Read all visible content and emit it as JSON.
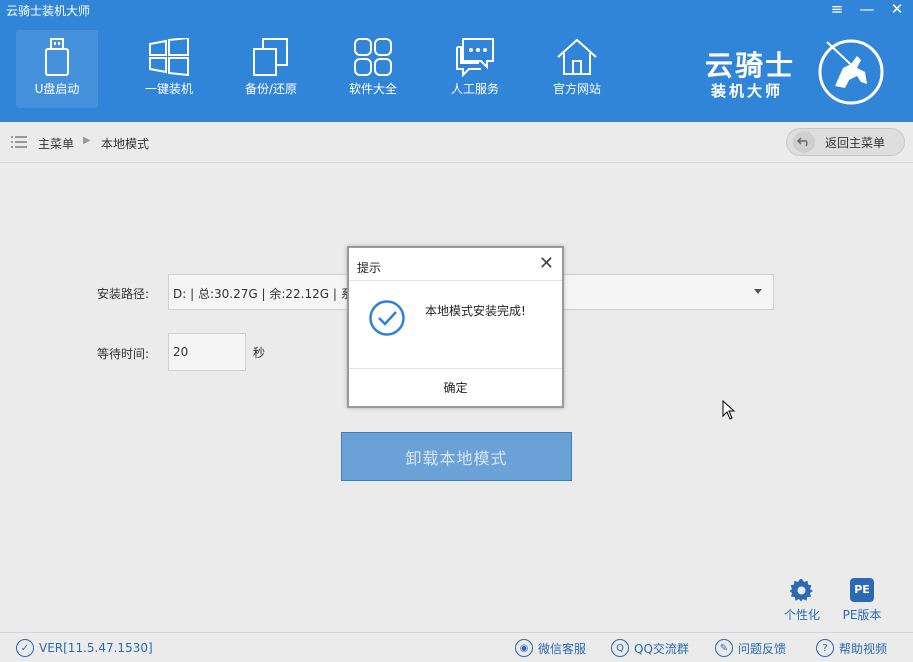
{
  "app": {
    "title": "云骑士装机大师"
  },
  "window_controls": {
    "menu": "≡",
    "minimize": "—",
    "close": "✕"
  },
  "nav": [
    {
      "label": "U盘启动",
      "icon": "usb-drive-icon"
    },
    {
      "label": "一键装机",
      "icon": "windows-icon"
    },
    {
      "label": "备份/还原",
      "icon": "backup-icon"
    },
    {
      "label": "软件大全",
      "icon": "apps-grid-icon"
    },
    {
      "label": "人工服务",
      "icon": "chat-icon"
    },
    {
      "label": "官方网站",
      "icon": "home-icon"
    }
  ],
  "brand": {
    "name": "云骑士",
    "sub": "装机大师"
  },
  "breadcrumb": {
    "main": "主菜单",
    "separator": "▶",
    "current": "本地模式"
  },
  "back_button": {
    "label": "返回主菜单"
  },
  "form": {
    "path_label": "安装路径:",
    "path_value": "D: | 总:30.27G | 余:22.12G | 系统",
    "wait_label": "等待时间:",
    "wait_value": "20",
    "wait_unit": "秒"
  },
  "uninstall_button": {
    "label": "卸载本地模式"
  },
  "dialog": {
    "title": "提示",
    "close": "✕",
    "message": "本地模式安装完成!",
    "ok": "确定"
  },
  "tools": [
    {
      "label": "个性化",
      "icon": "gear-icon"
    },
    {
      "label": "PE版本",
      "icon": "pe-icon",
      "badge": "PE"
    }
  ],
  "footer": {
    "version": "VER[11.5.47.1530]",
    "links": [
      "微信客服",
      "QQ交流群",
      "问题反馈",
      "帮助视频"
    ]
  },
  "colors": {
    "header": "#3185d8",
    "accent": "#2b6ab3",
    "button": "#6aa1d6"
  }
}
